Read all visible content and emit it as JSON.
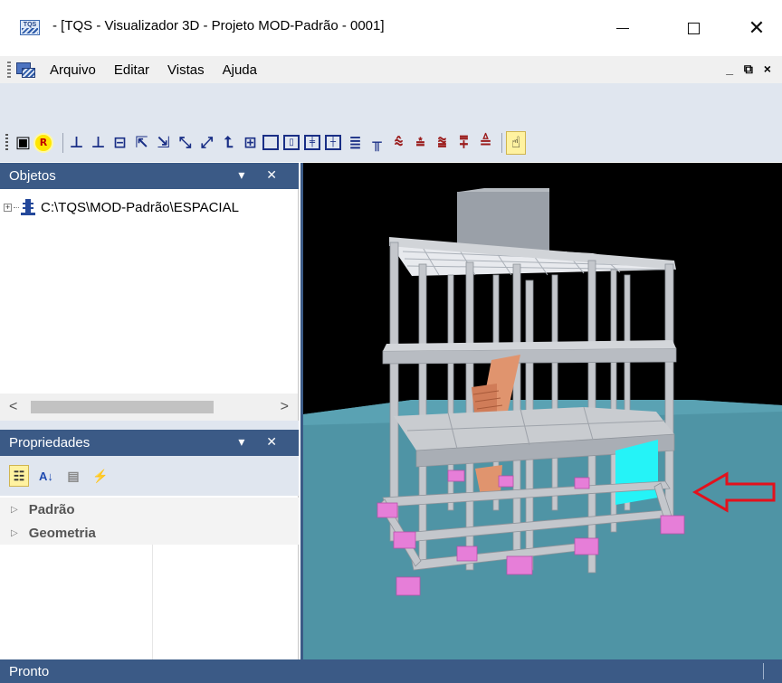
{
  "window": {
    "title": "- [TQS - Visualizador 3D - Projeto MOD-Padrão - 0001]",
    "logo_text": "TQS",
    "minimize": "—",
    "maximize": "☐",
    "close": "✕"
  },
  "menu": {
    "items": [
      "Arquivo",
      "Editar",
      "Vistas",
      "Ajuda"
    ],
    "mdi_controls": "_ ⧉ ×"
  },
  "toolbar": {
    "buttons": [
      {
        "name": "save-icon",
        "glyph": "▣"
      },
      {
        "name": "render-icon",
        "glyph": "R"
      },
      {
        "name": "elevation-z-icon",
        "glyph": "⊥"
      },
      {
        "name": "elevation-zneg-icon",
        "glyph": "⊥"
      },
      {
        "name": "plan-xy-icon",
        "glyph": "⊟"
      },
      {
        "name": "view-a-icon",
        "glyph": "⇱"
      },
      {
        "name": "view-b-icon",
        "glyph": "⇲"
      },
      {
        "name": "view-c-icon",
        "glyph": "⤡"
      },
      {
        "name": "view-d-icon",
        "glyph": "⤢"
      },
      {
        "name": "axes-icon",
        "glyph": "⮤"
      },
      {
        "name": "panel-icon",
        "glyph": "⊞"
      },
      {
        "name": "frame-1-icon",
        "glyph": ""
      },
      {
        "name": "frame-2-icon",
        "glyph": "▯"
      },
      {
        "name": "frame-3-icon",
        "glyph": "╪"
      },
      {
        "name": "frame-4-icon",
        "glyph": "┼"
      },
      {
        "name": "layers-icon",
        "glyph": "≣"
      },
      {
        "name": "column-icon",
        "glyph": "╥"
      },
      {
        "name": "floors-1-icon",
        "glyph": "⩯"
      },
      {
        "name": "floors-2-icon",
        "glyph": "⩮"
      },
      {
        "name": "floors-3-icon",
        "glyph": "⩰"
      },
      {
        "name": "floors-4-icon",
        "glyph": "⩱"
      },
      {
        "name": "floors-color-icon",
        "glyph": "≜"
      }
    ],
    "pointer_glyph": "☝"
  },
  "objects_panel": {
    "title": "Objetos",
    "controls": "▾ ✕",
    "tree": [
      {
        "label": "C:\\TQS\\MOD-Padrão\\ESPACIAL",
        "expander": "+"
      }
    ],
    "scroll_left": "<",
    "scroll_right": ">"
  },
  "properties_panel": {
    "title": "Propriedades",
    "controls": "▾ ✕",
    "toolbar": {
      "categorized": "☷",
      "alphabetical": "A↓",
      "pages": "▤",
      "events": "⚡"
    },
    "categories": [
      {
        "label": "Padrão",
        "expander": "▷"
      },
      {
        "label": "Geometria",
        "expander": "▷"
      }
    ]
  },
  "viewport": {
    "colors": {
      "background": "#000000",
      "ground": "#4f94a5",
      "structure": "#c4c7cc",
      "footings": "#e67ed8",
      "stairs": "#e0946e",
      "highlight_panel": "#25f3f7",
      "arrow": "#e3111c"
    }
  },
  "status": {
    "text": "Pronto"
  }
}
